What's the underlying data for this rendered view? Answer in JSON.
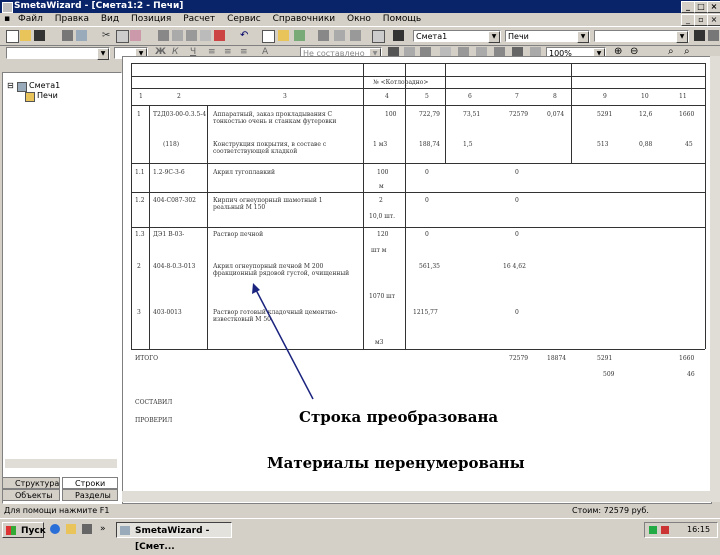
{
  "window": {
    "title": "SmetaWizard - [Смета1:2 - Печи]"
  },
  "menu": [
    "Файл",
    "Правка",
    "Вид",
    "Позиция",
    "Расчет",
    "Сервис",
    "Справочники",
    "Окно",
    "Помощь"
  ],
  "toolbar": {
    "doc_combo": "Смета1",
    "section_combo": "Печи",
    "zoom_combo": "100%",
    "style_combo": "Не составлено ...ые",
    "blank_combo": "",
    "blank_combo2": ""
  },
  "tree": {
    "root": "Смета1",
    "child": "Печи"
  },
  "panel_tabs": [
    "Структура",
    "Строки",
    "Объекты",
    "Разделы"
  ],
  "doc": {
    "section_header": "№ <Котлорадно>",
    "col_nums": [
      "1",
      "2",
      "3",
      "4",
      "5",
      "6",
      "7",
      "8",
      "9",
      "10",
      "11"
    ],
    "rows": [
      {
        "n": "1",
        "code": "Т2Д03-00-0.3.5-4",
        "name": "Аппаратный, заказ прокладывания С тонкостью очень и станкам футеровки",
        "unit": "100",
        "q": "722,79",
        "p": "73,51",
        "t": "72579",
        "a": "0,074",
        "b": "5291",
        "c": "12,6",
        "d": "1660"
      },
      {
        "n": "",
        "code": "(118)",
        "name": "Конструкция покрытия, в составе с соответствующей кладкой",
        "unit": "1 м3",
        "q": "188,74",
        "p": "1,5",
        "t": "",
        "a": "",
        "b": "513",
        "c": "0,88",
        "d": "45"
      },
      {
        "n": "1.1",
        "code": "1.2-9С-3-6",
        "name": "Акрил тугоплавкий",
        "unit": "100",
        "q": "0",
        "p": "",
        "t": "0",
        "a": "",
        "b": "",
        "c": "",
        "d": ""
      },
      {
        "n": "1.2",
        "code": "404-С087-302",
        "name": "Кирпич огнеупорный шамотный 1 реальный М 150",
        "unit": "2",
        "q": "0",
        "p": "",
        "t": "0",
        "a": "",
        "b": "",
        "c": "",
        "d": ""
      },
      {
        "n": "1.3",
        "code": "ДЭ1 В-03-",
        "name": "Раствор печной",
        "unit": "120",
        "q": "0",
        "p": "",
        "t": "0",
        "a": "",
        "b": "",
        "c": "",
        "d": ""
      },
      {
        "n": "2",
        "code": "404-8-0.3-013",
        "name": "Акрил огнеупорный печной М 200 фракционный рядовой густой, очищенный",
        "unit": "",
        "q": "561,35",
        "p": "",
        "t": "16 4,62",
        "a": "",
        "b": "",
        "c": "",
        "d": ""
      },
      {
        "n": "3",
        "code": "403-0013",
        "name": "Раствор готовый кладочный цементно-известковый М 50",
        "unit": "",
        "q": "1215,77",
        "p": "",
        "t": "0",
        "a": "",
        "b": "",
        "c": "",
        "d": ""
      }
    ],
    "units_extra": [
      "м",
      "10,0 шт.",
      "шт м",
      "1070 шт",
      "м3"
    ],
    "total_label": "ИТОГО",
    "total": {
      "t": "72579",
      "a": "18874",
      "b": "5291",
      "d": "1660"
    },
    "total2": {
      "b": "509",
      "d": "46"
    },
    "sign1": "СОСТАВИЛ",
    "sign2": "ПРОВЕРИЛ"
  },
  "annotations": {
    "arrow_text": "Строка преобразована",
    "bottom_text": "Материалы перенумерованы"
  },
  "status": {
    "left": "Для помощи нажмите F1",
    "right": "Стоим: 72579 руб."
  },
  "taskbar": {
    "start": "Пуск",
    "app": "SmetaWizard - [Смет...",
    "clock": "16:15"
  },
  "colors": {
    "titlebar": "#0a246a",
    "face": "#d4d0c8",
    "arrow": "#1a237e"
  }
}
